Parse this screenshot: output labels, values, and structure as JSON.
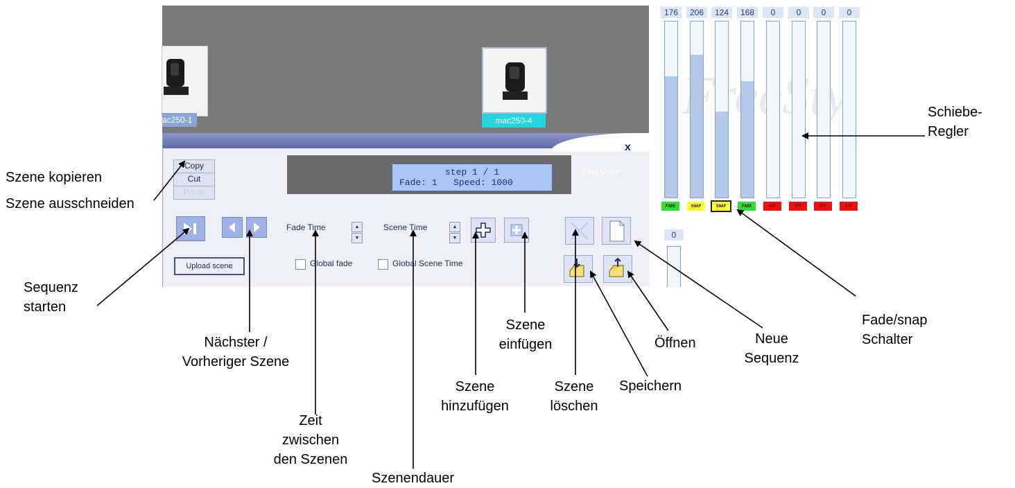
{
  "stage": {
    "fixtures": [
      {
        "name": "ac250-1"
      },
      {
        "name": "mac250-4"
      }
    ]
  },
  "panel": {
    "close_glyph": "x",
    "logo": "FreeStyler",
    "clipboard": {
      "copy": "Copy",
      "cut": "Cut",
      "paste": "Paste"
    },
    "display": {
      "line1": "step 1 / 1",
      "line2": "Fade: 1   Speed: 1000"
    },
    "fade_time_label": "Fade Time",
    "scene_time_label": "Scene Time",
    "global_fade_label": "Global fade",
    "global_scene_time_label": "Global Scene Time",
    "upload_scene_label": "Upload scene",
    "icons": {
      "play": "play-sequence-icon",
      "prev": "previous-scene-icon",
      "next": "next-scene-icon",
      "add": "add-scene-icon",
      "insert": "insert-scene-icon",
      "delete": "delete-scene-icon",
      "new": "new-sequence-icon",
      "save": "save-icon",
      "open": "open-icon"
    },
    "colors": {
      "accent": "#5c69a8",
      "display_bg": "#a9c6f5"
    }
  },
  "faders": {
    "channels": [
      {
        "value": "176",
        "level": 0.69,
        "mode": "FADE",
        "mode_color": "#33dd33"
      },
      {
        "value": "206",
        "level": 0.81,
        "mode": "SNAP",
        "mode_color": "#ffff33"
      },
      {
        "value": "124",
        "level": 0.49,
        "mode": "SNAP",
        "mode_color": "#ffff33"
      },
      {
        "value": "168",
        "level": 0.66,
        "mode": "FADE",
        "mode_color": "#33dd33"
      },
      {
        "value": "0",
        "level": 0,
        "mode": "OFF",
        "mode_color": "#ee1111"
      },
      {
        "value": "0",
        "level": 0,
        "mode": "OFF",
        "mode_color": "#ee1111"
      },
      {
        "value": "0",
        "level": 0,
        "mode": "OFF",
        "mode_color": "#ee1111"
      },
      {
        "value": "0",
        "level": 0,
        "mode": "OFF",
        "mode_color": "#ee1111"
      }
    ],
    "second_row_value": "0",
    "watermark": "FreeSty"
  },
  "annotations": {
    "szene_kopieren": "Szene kopieren",
    "szene_ausschneiden": "Szene ausschneiden",
    "sequenz_starten": [
      "Sequenz",
      "starten"
    ],
    "naechster": [
      "Nächster /",
      "Vorheriger Szene"
    ],
    "zeit_zwischen": [
      "Zeit",
      "zwischen",
      "den Szenen"
    ],
    "szenendauer": "Szenendauer",
    "szene_hinzufuegen": [
      "Szene",
      "hinzufügen"
    ],
    "szene_einfuegen": [
      "Szene",
      "einfügen"
    ],
    "szene_loeschen": [
      "Szene",
      "löschen"
    ],
    "speichern": "Speichern",
    "oeffnen": "Öffnen",
    "neue_sequenz": [
      "Neue",
      "Sequenz"
    ],
    "schiebe_regler": [
      "Schiebe-",
      "Regler"
    ],
    "fade_snap": [
      "Fade/snap",
      "Schalter"
    ]
  }
}
